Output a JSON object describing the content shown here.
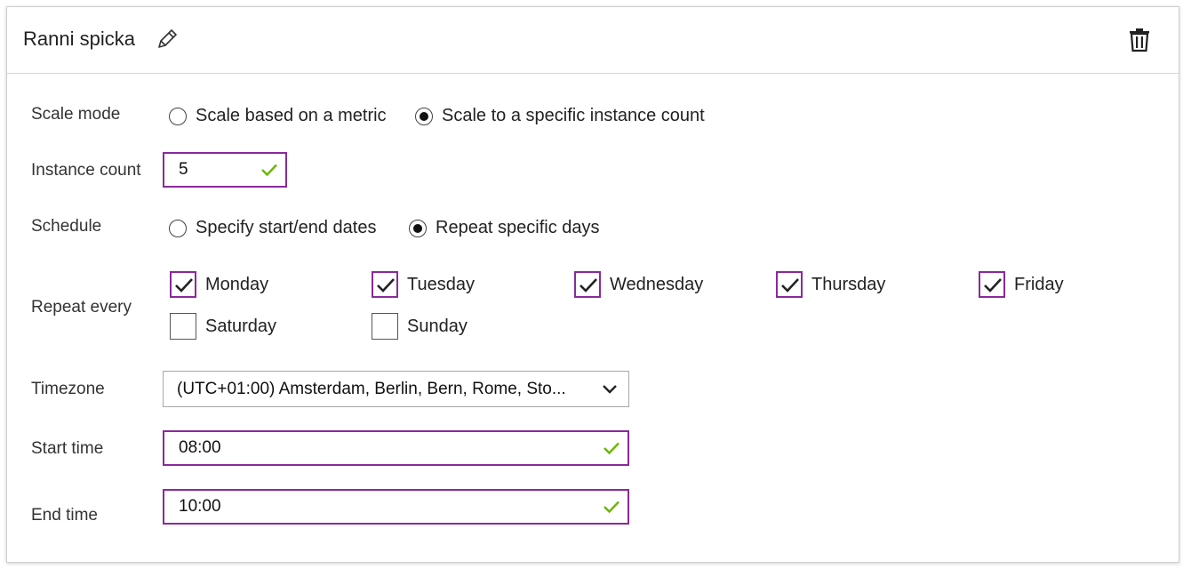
{
  "header": {
    "title": "Ranni spicka"
  },
  "scale_mode": {
    "label": "Scale mode",
    "options": [
      {
        "label": "Scale based on a metric",
        "selected": false
      },
      {
        "label": "Scale to a specific instance count",
        "selected": true
      }
    ]
  },
  "instance_count": {
    "label": "Instance count",
    "value": "5"
  },
  "schedule": {
    "label": "Schedule",
    "options": [
      {
        "label": "Specify start/end dates",
        "selected": false
      },
      {
        "label": "Repeat specific days",
        "selected": true
      }
    ]
  },
  "repeat_every": {
    "label": "Repeat every",
    "days": [
      {
        "label": "Monday",
        "checked": true
      },
      {
        "label": "Tuesday",
        "checked": true
      },
      {
        "label": "Wednesday",
        "checked": true
      },
      {
        "label": "Thursday",
        "checked": true
      },
      {
        "label": "Friday",
        "checked": true
      },
      {
        "label": "Saturday",
        "checked": false
      },
      {
        "label": "Sunday",
        "checked": false
      }
    ]
  },
  "timezone": {
    "label": "Timezone",
    "value": "(UTC+01:00) Amsterdam, Berlin, Bern, Rome, Sto..."
  },
  "start_time": {
    "label": "Start time",
    "value": "08:00"
  },
  "end_time": {
    "label": "End time",
    "value": "10:00"
  },
  "colors": {
    "accent": "#8a2a9c",
    "valid": "#6bb700"
  },
  "icons": {
    "edit": "pencil-icon",
    "delete": "trash-icon",
    "valid": "checkmark-icon",
    "dropdown": "chevron-down-icon"
  }
}
